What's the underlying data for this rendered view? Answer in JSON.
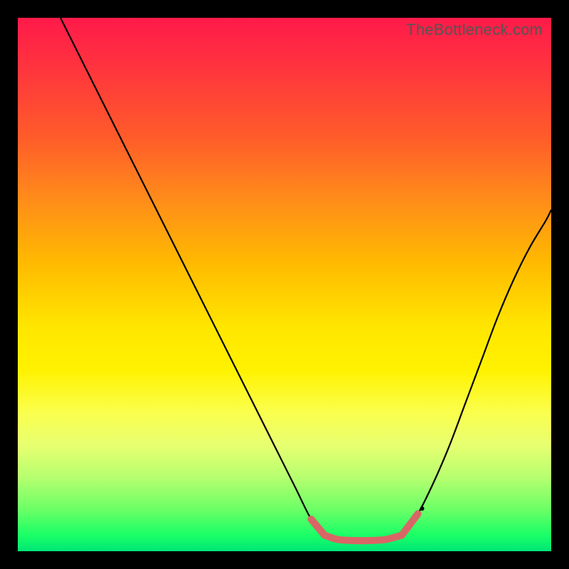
{
  "watermark": "TheBottleneck.com",
  "chart_data": {
    "type": "line",
    "title": "",
    "xlabel": "",
    "ylabel": "",
    "xlim": [
      0,
      100
    ],
    "ylim": [
      0,
      100
    ],
    "grid": false,
    "legend": false,
    "series": [
      {
        "name": "left-branch",
        "color": "#000000",
        "x": [
          8,
          12,
          16,
          20,
          24,
          28,
          32,
          36,
          40,
          44,
          48,
          52,
          55,
          57.5
        ],
        "y": [
          100,
          92,
          84,
          76,
          68,
          60,
          52,
          44,
          36,
          28,
          20,
          12,
          6,
          3
        ]
      },
      {
        "name": "valley-floor",
        "color": "#000000",
        "x": [
          57.5,
          60,
          63,
          66,
          69,
          72
        ],
        "y": [
          3,
          2.2,
          2,
          2,
          2.2,
          3
        ]
      },
      {
        "name": "right-branch",
        "color": "#000000",
        "x": [
          72,
          75,
          78,
          81,
          84,
          87,
          90,
          93,
          96,
          99,
          100
        ],
        "y": [
          3,
          7,
          13,
          20,
          28,
          36,
          44,
          51,
          57,
          62,
          64
        ]
      },
      {
        "name": "left-highlight",
        "color": "#d96666",
        "thick": true,
        "x": [
          55,
          56,
          57,
          57.5
        ],
        "y": [
          6,
          4.8,
          3.6,
          3
        ]
      },
      {
        "name": "floor-highlight",
        "color": "#d96666",
        "thick": true,
        "x": [
          57.5,
          60,
          63,
          66,
          69,
          72
        ],
        "y": [
          3,
          2.2,
          2,
          2,
          2.2,
          3
        ]
      },
      {
        "name": "right-highlight",
        "color": "#d96666",
        "thick": true,
        "x": [
          72,
          73.5,
          75
        ],
        "y": [
          3,
          5,
          7
        ]
      }
    ],
    "scatter": [
      {
        "name": "marker-left",
        "color": "#d96666",
        "x": 55,
        "y": 6,
        "r": 4
      },
      {
        "name": "marker-right",
        "color": "#d96666",
        "x": 75,
        "y": 7,
        "r": 4
      },
      {
        "name": "marker-dot",
        "color": "#000000",
        "x": 75.8,
        "y": 8,
        "r": 3
      }
    ]
  }
}
